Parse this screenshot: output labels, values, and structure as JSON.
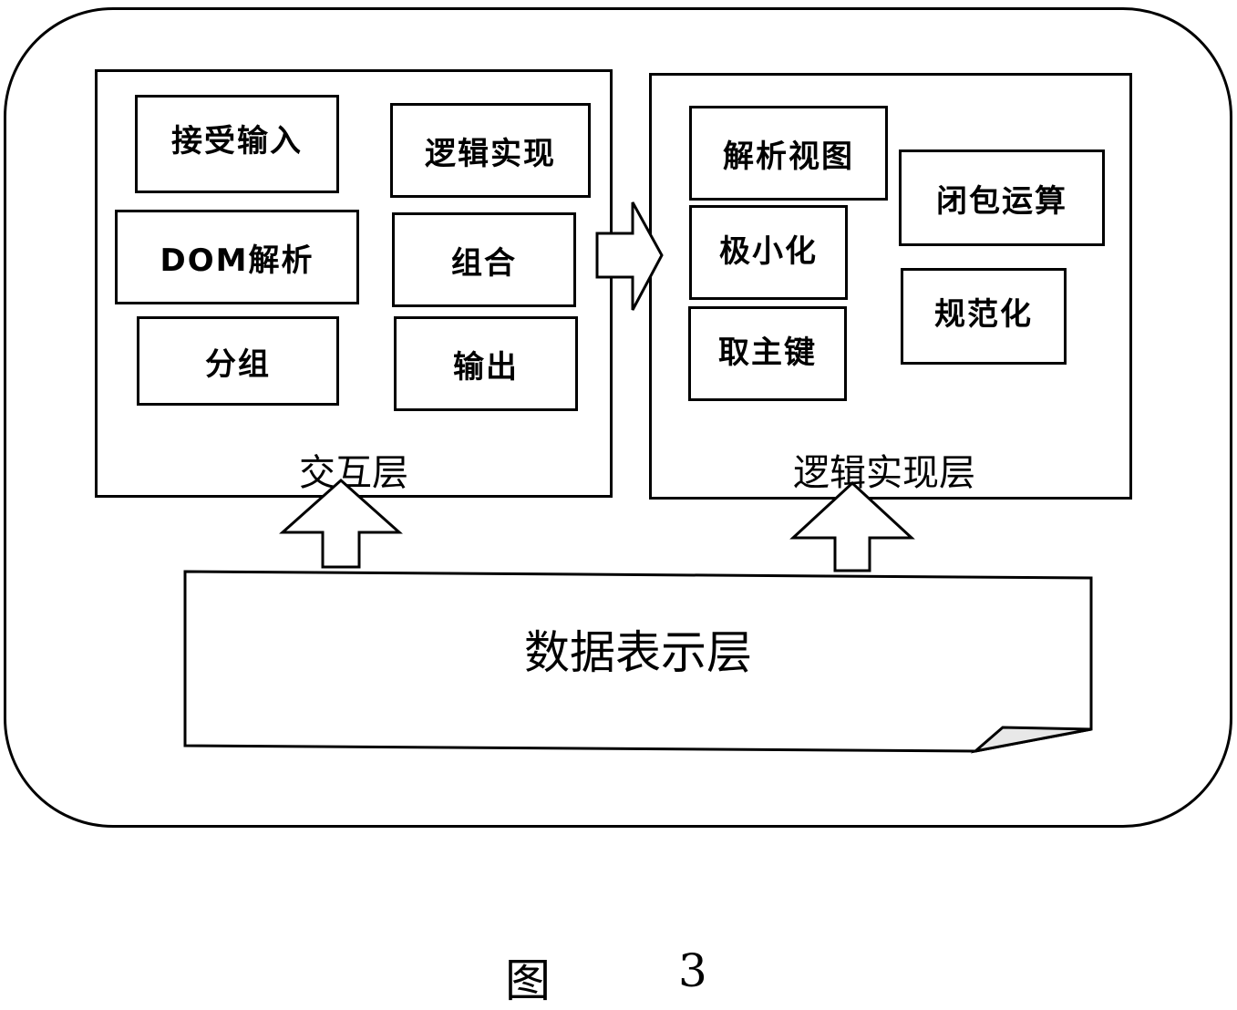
{
  "diagram": {
    "interaction_layer": {
      "label": "交互层",
      "modules": [
        "接受输入",
        "逻辑实现",
        "DOM解析",
        "组合",
        "分组",
        "输出"
      ]
    },
    "logic_layer": {
      "label": "逻辑实现层",
      "modules": [
        "解析视图",
        "闭包运算",
        "极小化",
        "规范化",
        "取主键"
      ]
    },
    "data_layer": {
      "label": "数据表示层"
    },
    "arrows": [
      {
        "from": "交互层",
        "to": "逻辑实现层",
        "direction": "right"
      },
      {
        "from": "数据表示层",
        "to": "交互层",
        "direction": "up"
      },
      {
        "from": "数据表示层",
        "to": "逻辑实现层",
        "direction": "up"
      }
    ]
  },
  "caption": {
    "prefix": "图",
    "number": "3"
  }
}
